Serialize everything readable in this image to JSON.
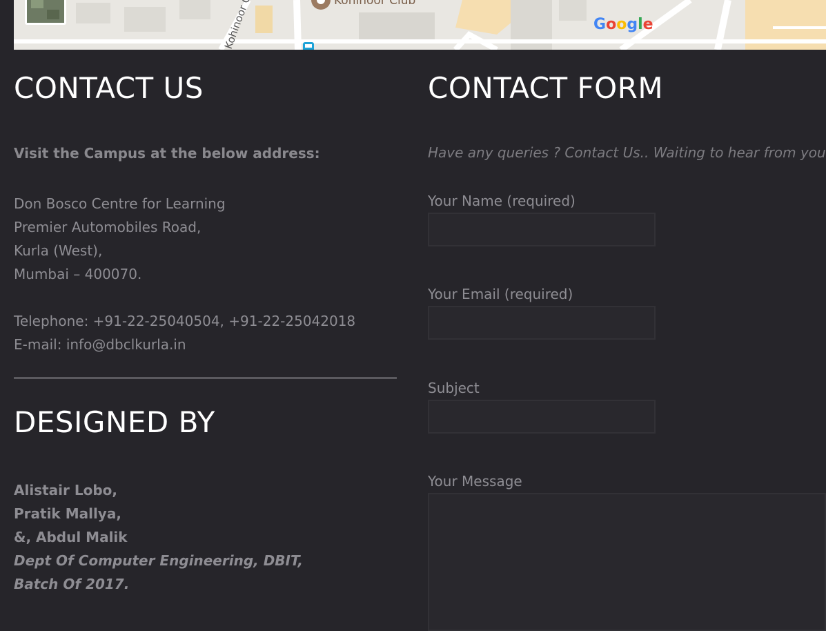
{
  "map": {
    "place_label": "Kohinoor Club",
    "street_label": "Kohinoor City R",
    "logo_text": "Google",
    "logo_colors": [
      "#4285F4",
      "#EA4335",
      "#FBBC05",
      "#4285F4",
      "#34A853",
      "#EA4335"
    ]
  },
  "contact": {
    "heading": "CONTACT US",
    "intro": "Visit the Campus at the below address:",
    "address_lines": [
      "Don Bosco Centre for Learning",
      "Premier Automobiles Road,",
      "Kurla (West),",
      "Mumbai – 400070."
    ],
    "telephone_label": "Telephone:",
    "telephone_value": "+91-22-25040504, +91-22-25042018",
    "email_label": "E-mail:",
    "email_value": "info@dbclkurla.in"
  },
  "designed_by": {
    "heading": "DESIGNED BY",
    "names": [
      "Alistair Lobo,",
      "Pratik Mallya,",
      "&, Abdul Malik"
    ],
    "dept": "Dept Of Computer Engineering, DBIT,",
    "batch": "Batch Of 2017."
  },
  "form": {
    "heading": "CONTACT FORM",
    "intro": "Have any queries ? Contact Us.. Waiting to hear from you...",
    "name_label": "Your Name (required)",
    "name_value": "",
    "email_label": "Your Email (required)",
    "email_value": "",
    "subject_label": "Subject",
    "subject_value": "",
    "message_label": "Your Message",
    "message_value": ""
  },
  "colors": {
    "background": "#26252a",
    "heading": "#ffffff",
    "text": "#8e8d93",
    "divider": "#5b5a5f",
    "input_bg": "#29282d",
    "input_border": "#323136"
  }
}
